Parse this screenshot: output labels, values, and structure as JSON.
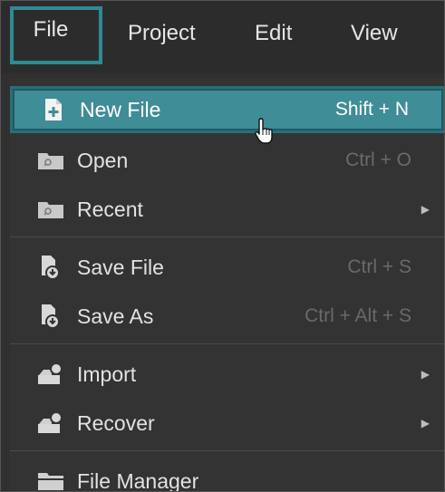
{
  "menubar": {
    "items": [
      {
        "label": "File"
      },
      {
        "label": "Project"
      },
      {
        "label": "Edit"
      },
      {
        "label": "View"
      }
    ]
  },
  "file_menu": {
    "items": [
      {
        "label": "New File",
        "shortcut": "Shift + N",
        "icon": "new-file-icon",
        "highlighted": true
      },
      {
        "label": "Open",
        "shortcut": "Ctrl + O",
        "icon": "folder-search-icon"
      },
      {
        "label": "Recent",
        "shortcut": "",
        "icon": "folder-search-icon",
        "submenu": true
      },
      {
        "label": "Save File",
        "shortcut": "Ctrl + S",
        "icon": "save-file-icon"
      },
      {
        "label": "Save As",
        "shortcut": "Ctrl + Alt + S",
        "icon": "save-file-icon"
      },
      {
        "label": "Import",
        "shortcut": "",
        "icon": "import-icon",
        "submenu": true
      },
      {
        "label": "Recover",
        "shortcut": "",
        "icon": "recover-icon",
        "submenu": true
      },
      {
        "label": "File Manager",
        "shortcut": "",
        "icon": "folder-icon"
      }
    ]
  },
  "colors": {
    "highlight": "#3f8d96",
    "menu_bg": "#333333",
    "text": "#e2e2e2",
    "shortcut_text": "#6a6a6a"
  }
}
